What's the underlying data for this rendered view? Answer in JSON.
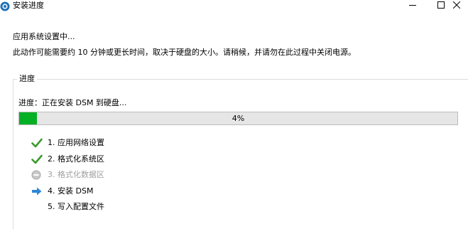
{
  "window": {
    "title": "安装进度"
  },
  "status": {
    "heading": "应用系统设置中...",
    "description": "此动作可能需要约 10 分钟或更长时间，取决于硬盘的大小。请稍候，并请勿在此过程中关闭电源。"
  },
  "progress_group": {
    "legend": "进度",
    "label": "进度：正在安装 DSM 到硬盘...",
    "percent_text": "4%",
    "percent_value": 4,
    "fill_color": "#06b025"
  },
  "steps": [
    {
      "label": "1. 应用网络设置",
      "state": "done",
      "icon": "check-icon"
    },
    {
      "label": "2. 格式化系统区",
      "state": "done",
      "icon": "check-icon"
    },
    {
      "label": "3. 格式化数据区",
      "state": "skipped",
      "icon": "minus-circle-icon"
    },
    {
      "label": "4. 安装 DSM",
      "state": "current",
      "icon": "arrow-right-icon"
    },
    {
      "label": "5. 写入配置文件",
      "state": "pending",
      "icon": ""
    }
  ],
  "colors": {
    "check": "#3a9a2a",
    "arrow": "#2f86d6",
    "disabled": "#a0a0a0"
  }
}
